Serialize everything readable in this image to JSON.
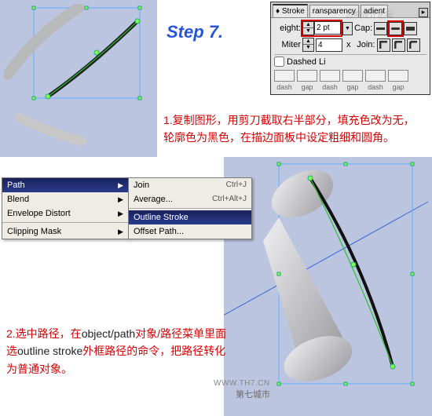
{
  "step_title": "Step 7.",
  "stroke_panel": {
    "tabs": [
      "Stroke",
      "ransparency",
      "adient"
    ],
    "weight_label": "eight:",
    "weight_value": "2 pt",
    "cap_label": "Cap:",
    "miter_label": "Miter",
    "miter_value": "4",
    "miter_x": "x",
    "join_label": "Join:",
    "dashed_label": "Dashed Li",
    "dash_labels": [
      "dash",
      "gap",
      "dash",
      "gap",
      "dash",
      "gap"
    ]
  },
  "desc1": "1.复制图形，用剪刀截取右半部分，填充色改为无，轮廓色为黑色，在描边面板中设定粗细和圆角。",
  "desc2_parts": {
    "a": "2.选中路径，在",
    "b": "object/path",
    "c": "对象/路径菜单里面选",
    "d": "outline stroke",
    "e": "外框路径的命令，把路径转化为普通对象。"
  },
  "menu": {
    "items": [
      {
        "label": "Path",
        "arrow": true,
        "sel": true
      },
      {
        "label": "Blend",
        "arrow": true
      },
      {
        "label": "Envelope Distort",
        "arrow": true
      },
      {
        "sep": true
      },
      {
        "label": "Clipping Mask",
        "arrow": true
      }
    ]
  },
  "submenu": {
    "items": [
      {
        "label": "Join",
        "sc": "Ctrl+J"
      },
      {
        "label": "Average...",
        "sc": "Ctrl+Alt+J"
      },
      {
        "sep": true
      },
      {
        "label": "Outline Stroke",
        "sel": true
      },
      {
        "label": "Offset Path..."
      }
    ]
  },
  "watermark": "WWW.TH7.CN",
  "watermark2": "第七城市",
  "wm_top": "忽略设计论坛"
}
